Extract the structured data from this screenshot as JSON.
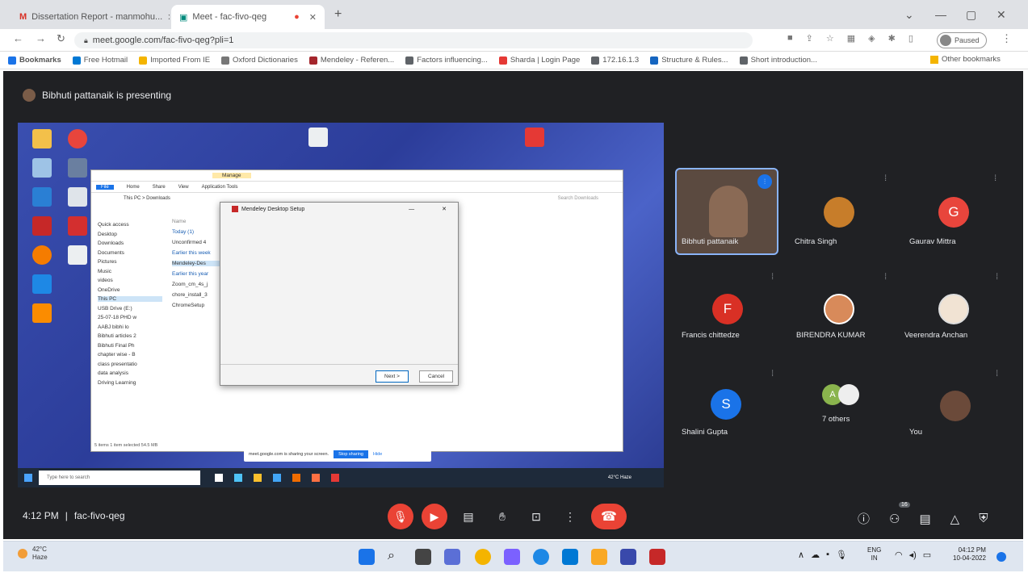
{
  "browser": {
    "tabs": [
      {
        "label": "Dissertation Report - manmohu...",
        "icon": "gmail-icon"
      },
      {
        "label": "Meet - fac-fivo-qeg",
        "icon": "meet-icon",
        "recording": true
      }
    ],
    "new_tab": "+",
    "url": "meet.google.com/fac-fivo-qeg?pli=1",
    "profile_label": "Paused",
    "window_controls": {
      "chevron": "⌄",
      "minimize": "—",
      "restore": "▢",
      "close": "✕"
    }
  },
  "bookmarks": {
    "items": [
      {
        "label": "Bookmarks",
        "color": "#1a73e8"
      },
      {
        "label": "Free Hotmail",
        "color": "#0078d4"
      },
      {
        "label": "Imported From IE",
        "color": "#f4b400"
      },
      {
        "label": "Oxford Dictionaries",
        "color": "#777777"
      },
      {
        "label": "Mendeley - Referen...",
        "color": "#a4262c"
      },
      {
        "label": "Factors influencing...",
        "color": "#5f6368"
      },
      {
        "label": "Sharda | Login Page",
        "color": "#e53935"
      },
      {
        "label": "172.16.1.3",
        "color": "#5f6368"
      },
      {
        "label": "Structure & Rules...",
        "color": "#1565c0"
      },
      {
        "label": "Short introduction...",
        "color": "#5f6368"
      }
    ],
    "other": "Other bookmarks"
  },
  "meet": {
    "presenting_text": "Bibhuti pattanaik is presenting",
    "time": "4:12 PM",
    "separator": "|",
    "meeting_code": "fac-fivo-qeg",
    "participants_badge": "16",
    "participants": [
      {
        "name": "Bibhuti pattanaik",
        "type": "video",
        "speaking": true
      },
      {
        "name": "Chitra Singh",
        "type": "photo",
        "color": "#c77d2a"
      },
      {
        "name": "Gaurav Mittra",
        "type": "initial",
        "initial": "G",
        "color": "#e8453c"
      },
      {
        "name": "Francis chittedze",
        "type": "initial",
        "initial": "F",
        "color": "#d93025"
      },
      {
        "name": "BIRENDRA KUMAR",
        "type": "photo",
        "color": "#d88a5a"
      },
      {
        "name": "Veerendra Anchan",
        "type": "photo",
        "color": "#f1e3d3"
      },
      {
        "name": "Shalini Gupta",
        "type": "initial",
        "initial": "S",
        "color": "#1a73e8"
      },
      {
        "name": "7 others",
        "type": "group",
        "initial": "A",
        "color": "#8ab44d"
      },
      {
        "name": "You",
        "type": "photo",
        "color": "#6b4a3a"
      }
    ]
  },
  "shared_screen": {
    "setup_dialog": {
      "title": "Mendeley Desktop Setup",
      "next": "Next >",
      "cancel": "Cancel"
    },
    "explorer": {
      "tabs": [
        "File",
        "Home",
        "Share",
        "View",
        "Application Tools"
      ],
      "manage": "Manage",
      "breadcrumb": "This PC > Downloads",
      "search": "Search Downloads",
      "nav": [
        "Quick access",
        "Desktop",
        "Downloads",
        "Documents",
        "Pictures",
        "Music",
        "videos",
        "OneDrive",
        "This PC",
        "USB Drive (E:)",
        "25-07-18 PHD w",
        "AABJ bibhi lo",
        "Bibhuti articles 2",
        "Bibhuti Final Ph",
        "chapter wise - B",
        "class presentatio",
        "data analysis",
        "Driving Learning"
      ],
      "groups": [
        "Today (1)",
        "Earlier this week",
        "Earlier this year"
      ],
      "files": [
        "Unconfirmed 4",
        "Mendeley-Des",
        "Zoom_cm_4s_j",
        "chore_install_3",
        "ChromeSetup"
      ],
      "status": "5 items   1 item selected 54.5 MB",
      "name_header": "Name"
    },
    "share_bar": {
      "text": "meet.google.com is sharing your screen.",
      "stop": "Stop sharing",
      "hide": "Hide"
    },
    "taskbar": {
      "search": "Type here to search",
      "weather": "42°C Haze",
      "lang": "ENG IN"
    }
  },
  "windows_taskbar": {
    "weather_temp": "42°C",
    "weather_desc": "Haze",
    "lang": "ENG",
    "region": "IN",
    "time": "04:12 PM",
    "date": "10-04-2022"
  }
}
